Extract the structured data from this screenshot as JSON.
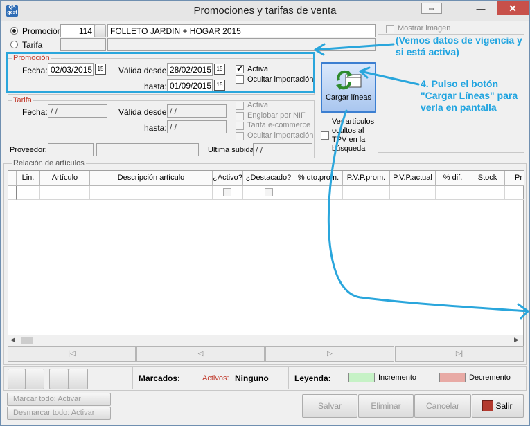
{
  "window": {
    "title": "Promociones y tarifas de venta",
    "app_icon": "QS gest",
    "restore_glyph": "⇔",
    "minimize_glyph": "—",
    "close_glyph": "✕"
  },
  "top": {
    "promocion_label": "Promoción",
    "promocion_code": "114",
    "promocion_name": "FOLLETO JARDIN + HOGAR 2015",
    "ellipsis": "···",
    "tarifa_label": "Tarifa",
    "mostrar_imagen": "Mostrar imagen"
  },
  "promocion_group": {
    "title": "Promoción",
    "fecha_label": "Fecha:",
    "fecha_value": "02/03/2015",
    "valida_desde_label": "Válida desde:",
    "valida_desde_value": "28/02/2015",
    "hasta_label": "hasta:",
    "hasta_value": "01/09/2015",
    "activa_label": "Activa",
    "activa_checked": true,
    "ocultar_label": "Ocultar importación",
    "cal_glyph": "15"
  },
  "tarifa_group": {
    "title": "Tarifa",
    "fecha_label": "Fecha:",
    "fecha_value": " / /",
    "valida_desde_label": "Válida desde:",
    "valida_desde_value": " / /",
    "hasta_label": "hasta:",
    "hasta_value": " / /",
    "activa_label": "Activa",
    "englobar_label": "Englobar por NIF",
    "ecommerce_label": "Tarifa e-commerce",
    "ocultar_label": "Ocultar importación",
    "proveedor_label": "Proveedor:",
    "ultima_label": "Ultima subida",
    "ultima_value": " / /"
  },
  "cargar": {
    "label": "Cargar líneas",
    "ver_ocultos": "Ver artículos ocultos al TPV en la búsqueda"
  },
  "grid": {
    "section_title": "Relación de artículos",
    "columns": [
      "Lin.",
      "Artículo",
      "Descripción artículo",
      "¿Activo?",
      "¿Destacado?",
      "% dto.prom.",
      "P.V.P.prom.",
      "P.V.P.actual",
      "% dif.",
      "Stock",
      "Pr"
    ]
  },
  "status": {
    "marcados_label": "Marcados:",
    "activos_label": "Activos:",
    "activos_value": "Ninguno",
    "leyenda_label": "Leyenda:",
    "incremento": "Incremento",
    "decremento": "Decremento",
    "incremento_color": "#c6f2c6",
    "decremento_color": "#e8aaa5"
  },
  "actions": {
    "marcar_todo": "Marcar todo: Activar",
    "desmarcar_todo": "Desmarcar todo: Activar",
    "salvar": "Salvar",
    "eliminar": "Eliminar",
    "cancelar": "Cancelar",
    "salir": "Salir"
  },
  "annotations": {
    "vigencia": "(Vemos datos de vigencia y si está activa)",
    "pulso": "4. Pulso el botón \"Cargar Líneas\" para verla en pantalla",
    "color": "#20a4e0"
  }
}
